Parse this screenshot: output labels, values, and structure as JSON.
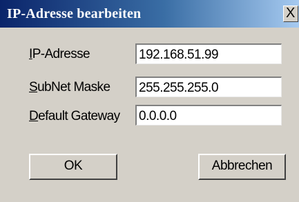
{
  "window": {
    "title": "IP-Adresse bearbeiten",
    "close_label": "X"
  },
  "form": {
    "ip": {
      "accel": "I",
      "label_rest": "P-Adresse",
      "value": "192.168.51.99"
    },
    "subnet": {
      "accel": "S",
      "label_rest": "ubNet Maske",
      "value": "255.255.255.0"
    },
    "gateway": {
      "accel": "D",
      "label_rest": "efault Gateway",
      "value": "0.0.0.0"
    }
  },
  "buttons": {
    "ok_label": "OK",
    "cancel_label": "Abbrechen"
  },
  "colors": {
    "titlebar_start": "#0a246a",
    "titlebar_end": "#a6caf0",
    "dialog_face": "#d4d0c8"
  }
}
